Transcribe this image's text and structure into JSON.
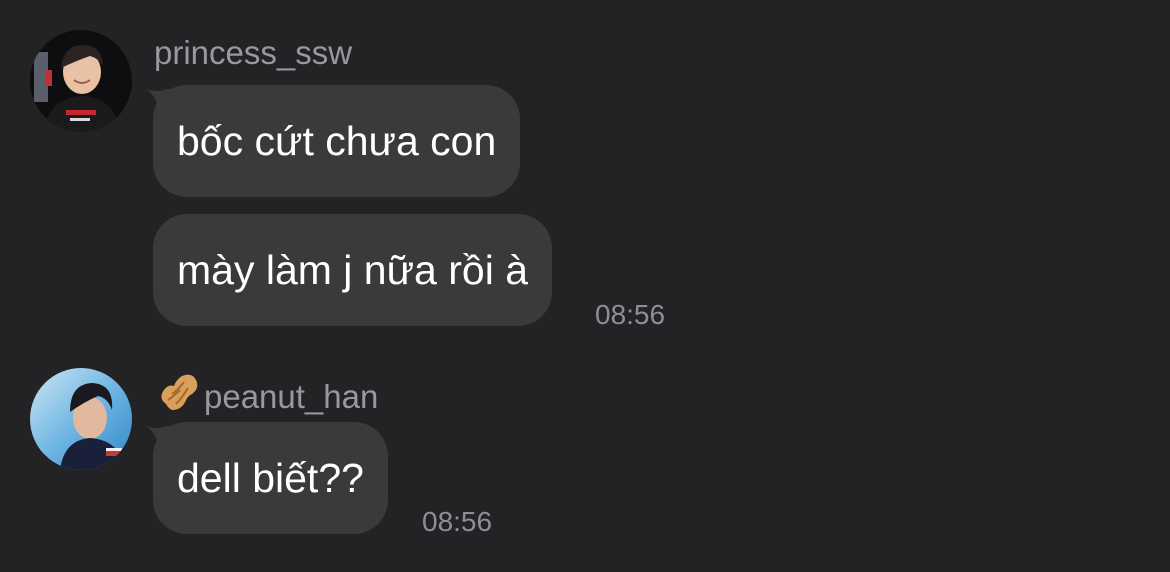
{
  "messages": [
    {
      "sender": "princess_ssw",
      "avatar": "avatar-princess",
      "bubbles": [
        "bốc cứt chưa con",
        "mày làm j nữa rồi à"
      ],
      "time": "08:56"
    },
    {
      "sender": "peanut_han",
      "sender_emoji": "peanut-icon",
      "avatar": "avatar-peanut",
      "bubbles": [
        "dell biết??"
      ],
      "time": "08:56"
    }
  ],
  "colors": {
    "background": "#232325",
    "bubble": "#3a3a3c",
    "sender_text": "#98989d",
    "time_text": "#8e8e93",
    "message_text": "#ffffff"
  }
}
